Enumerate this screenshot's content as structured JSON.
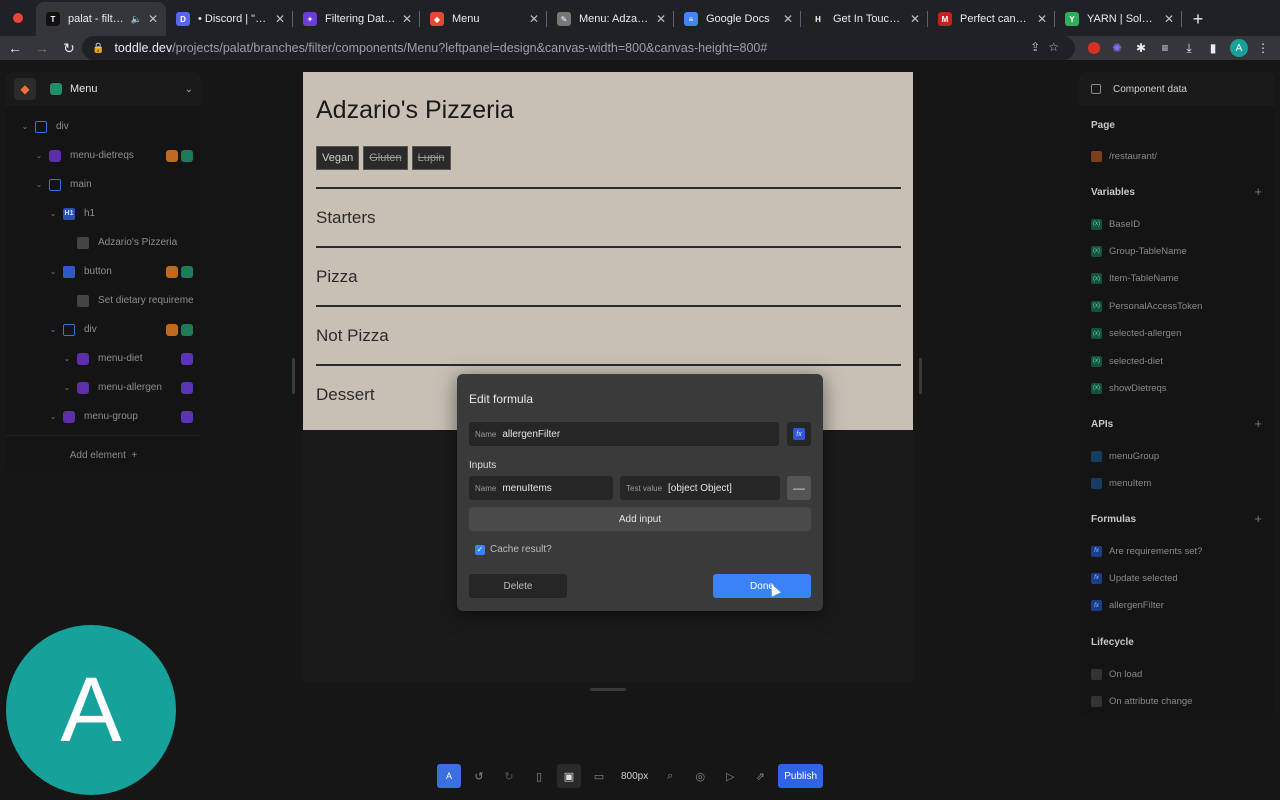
{
  "browser": {
    "tabs": [
      {
        "title": "palat - filter To",
        "favicon": "T",
        "fav_color": "#111111",
        "active": true,
        "audio": true
      },
      {
        "title": "• Discord | \"Filterin",
        "favicon": "D",
        "fav_color": "#5865f2"
      },
      {
        "title": "Filtering Data with",
        "favicon": "✦",
        "fav_color": "#6b3fd6"
      },
      {
        "title": "Menu",
        "favicon": "◆",
        "fav_color": "#e24a33"
      },
      {
        "title": "Menu: Adzario's It",
        "favicon": "✎",
        "fav_color": "#777777"
      },
      {
        "title": "Google Docs",
        "favicon": "≡",
        "fav_color": "#4285f4"
      },
      {
        "title": "Get In Touch | Hi M",
        "favicon": "H",
        "fav_color": "#222222"
      },
      {
        "title": "Perfect candidate",
        "favicon": "M",
        "fav_color": "#c5221f"
      },
      {
        "title": "YARN | Soldiers: O",
        "favicon": "Y",
        "fav_color": "#2fae60"
      }
    ],
    "url_host": "toddle.dev",
    "url_path": "/projects/palat/branches/filter/components/Menu?leftpanel=design&canvas-width=800&canvas-height=800#",
    "profile_initial": "A"
  },
  "left_panel": {
    "title": "Menu",
    "tree": [
      {
        "label": "div",
        "icon": "div",
        "depth": 0,
        "badges": []
      },
      {
        "label": "menu-dietreqs",
        "icon": "comp",
        "depth": 1,
        "badges": [
          "orange",
          "green"
        ]
      },
      {
        "label": "main",
        "icon": "div",
        "depth": 1,
        "badges": []
      },
      {
        "label": "h1",
        "icon": "h1",
        "depth": 2,
        "badges": []
      },
      {
        "label": "Adzario's Pizzeria",
        "icon": "text",
        "depth": 3,
        "badges": []
      },
      {
        "label": "button",
        "icon": "btn",
        "depth": 2,
        "badges": [
          "orange",
          "green"
        ]
      },
      {
        "label": "Set dietary requireme",
        "icon": "text",
        "depth": 3,
        "badges": []
      },
      {
        "label": "div",
        "icon": "div",
        "depth": 2,
        "badges": [
          "orange",
          "green"
        ]
      },
      {
        "label": "menu-diet",
        "icon": "comp",
        "depth": 3,
        "badges": [
          "purple"
        ]
      },
      {
        "label": "menu-allergen",
        "icon": "comp",
        "depth": 3,
        "badges": [
          "purple"
        ]
      },
      {
        "label": "menu-group",
        "icon": "comp",
        "depth": 2,
        "badges": [
          "purple"
        ]
      }
    ],
    "add_element": "Add element"
  },
  "preview": {
    "title": "Adzario's Pizzeria",
    "chips": [
      {
        "label": "Vegan",
        "active": true
      },
      {
        "label": "Gluten",
        "active": false
      },
      {
        "label": "Lupin",
        "active": false
      }
    ],
    "sections": [
      "Starters",
      "Pizza",
      "Not Pizza",
      "Dessert"
    ]
  },
  "modal": {
    "title": "Edit formula",
    "name_label": "Name",
    "name_value": "allergenFilter",
    "inputs_label": "Inputs",
    "input_name_label": "Name",
    "input_name_value": "menuItems",
    "test_value_label": "Test value",
    "test_value": "[object Object]",
    "add_input": "Add input",
    "cache_label": "Cache result?",
    "cache_checked": true,
    "delete": "Delete",
    "done": "Done"
  },
  "right_panel": {
    "header": "Component data",
    "page_label": "Page",
    "page_route": "/restaurant/",
    "variables_label": "Variables",
    "variables": [
      "BaseID",
      "Group-TableName",
      "Item-TableName",
      "PersonalAccessToken",
      "selected-allergen",
      "selected-diet",
      "showDietreqs"
    ],
    "apis_label": "APIs",
    "apis": [
      "menuGroup",
      "menuItem"
    ],
    "formulas_label": "Formulas",
    "formulas": [
      "Are requirements set?",
      "Update selected",
      "allergenFilter"
    ],
    "lifecycle_label": "Lifecycle",
    "lifecycle": [
      "On load",
      "On attribute change"
    ]
  },
  "bottom_bar": {
    "zoom": "800px",
    "publish": "Publish",
    "mode_letter": "A"
  },
  "overlay": {
    "avatar_initial": "A"
  }
}
